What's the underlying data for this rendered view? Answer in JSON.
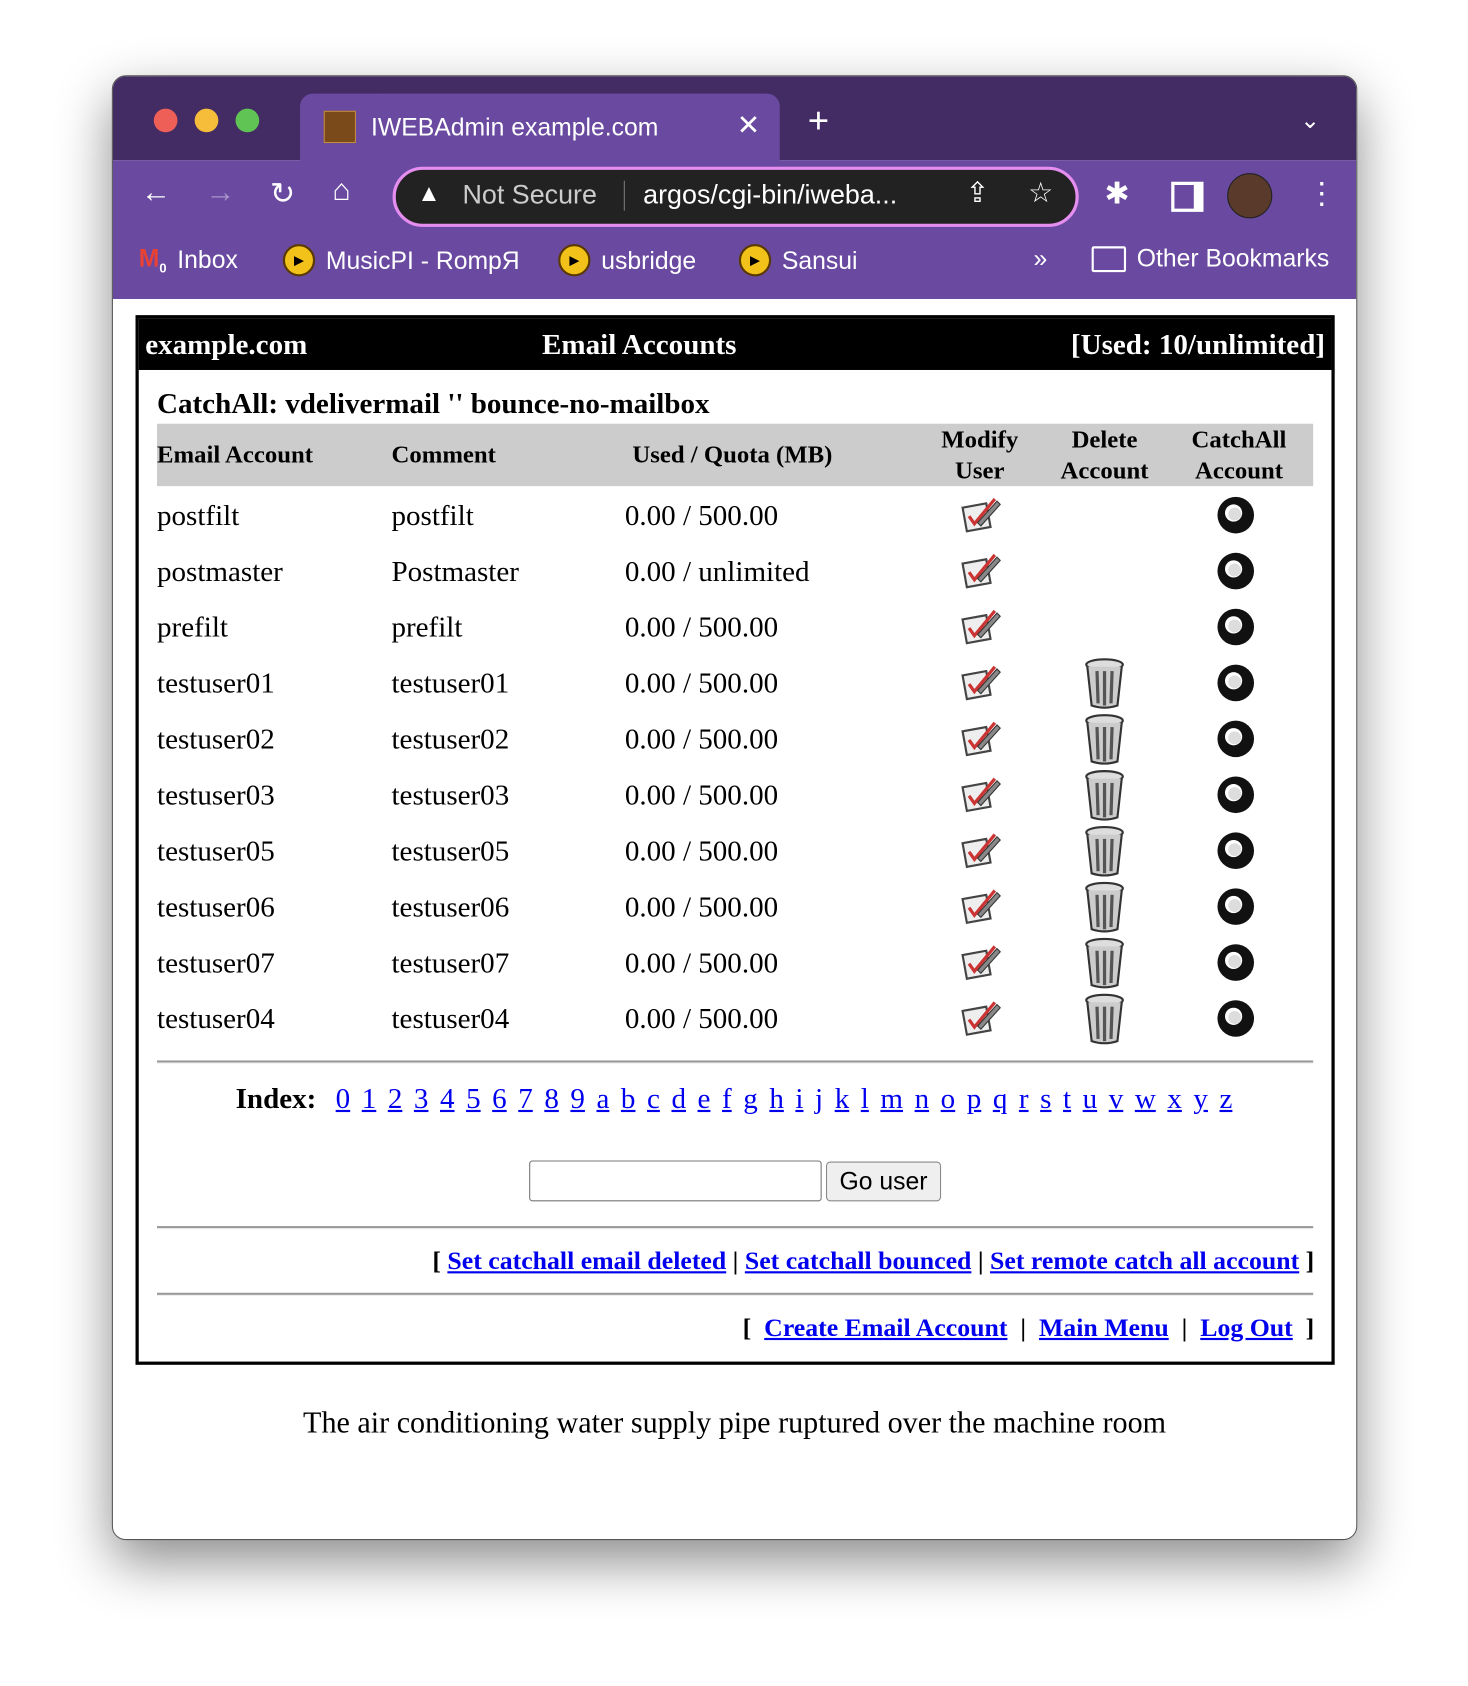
{
  "browser": {
    "tab_title": "IWEBAdmin example.com",
    "security_label": "Not Secure",
    "url": "argos/cgi-bin/iweba...",
    "bookmarks": [
      {
        "label": "Inbox",
        "icon": "gmail-icon",
        "badge": "0"
      },
      {
        "label": "MusicPI - RompЯ",
        "icon": "play-icon"
      },
      {
        "label": "usbridge",
        "icon": "play-icon"
      },
      {
        "label": "Sansui",
        "icon": "play-icon"
      }
    ],
    "overflow": "»",
    "other_bookmarks": "Other Bookmarks",
    "colors": {
      "frame": "#432c63",
      "toolbar": "#6a4aa0",
      "omnibox_border": "#e58ef0"
    }
  },
  "header": {
    "domain": "example.com",
    "title": "Email Accounts",
    "usage": "[Used: 10/unlimited]"
  },
  "catchall": "CatchAll: vdelivermail '' bounce-no-mailbox",
  "columns": {
    "email": "Email Account",
    "comment": "Comment",
    "quota": "Used / Quota (MB)",
    "modify": [
      "Modify",
      "User"
    ],
    "delete": [
      "Delete",
      "Account"
    ],
    "catchall": [
      "CatchAll",
      "Account"
    ]
  },
  "rows": [
    {
      "email": "postfilt",
      "comment": "postfilt",
      "quota": "0.00 / 500.00",
      "deletable": false
    },
    {
      "email": "postmaster",
      "comment": "Postmaster",
      "quota": "0.00 / unlimited",
      "deletable": false
    },
    {
      "email": "prefilt",
      "comment": "prefilt",
      "quota": "0.00 / 500.00",
      "deletable": false
    },
    {
      "email": "testuser01",
      "comment": "testuser01",
      "quota": "0.00 / 500.00",
      "deletable": true
    },
    {
      "email": "testuser02",
      "comment": "testuser02",
      "quota": "0.00 / 500.00",
      "deletable": true
    },
    {
      "email": "testuser03",
      "comment": "testuser03",
      "quota": "0.00 / 500.00",
      "deletable": true
    },
    {
      "email": "testuser05",
      "comment": "testuser05",
      "quota": "0.00 / 500.00",
      "deletable": true
    },
    {
      "email": "testuser06",
      "comment": "testuser06",
      "quota": "0.00 / 500.00",
      "deletable": true
    },
    {
      "email": "testuser07",
      "comment": "testuser07",
      "quota": "0.00 / 500.00",
      "deletable": true
    },
    {
      "email": "testuser04",
      "comment": "testuser04",
      "quota": "0.00 / 500.00",
      "deletable": true
    }
  ],
  "index": {
    "label": "Index:",
    "keys": [
      "0",
      "1",
      "2",
      "3",
      "4",
      "5",
      "6",
      "7",
      "8",
      "9",
      "a",
      "b",
      "c",
      "d",
      "e",
      "f",
      "g",
      "h",
      "i",
      "j",
      "k",
      "l",
      "m",
      "n",
      "o",
      "p",
      "q",
      "r",
      "s",
      "t",
      "u",
      "v",
      "w",
      "x",
      "y",
      "z"
    ]
  },
  "go_user": {
    "value": "",
    "button": "Go user"
  },
  "catchall_links": [
    "Set catchall email deleted",
    "Set catchall bounced",
    "Set remote catch all account"
  ],
  "nav_links": [
    "Create Email Account",
    "Main Menu",
    "Log Out"
  ],
  "footer": "The air conditioning water supply pipe ruptured over the machine room"
}
